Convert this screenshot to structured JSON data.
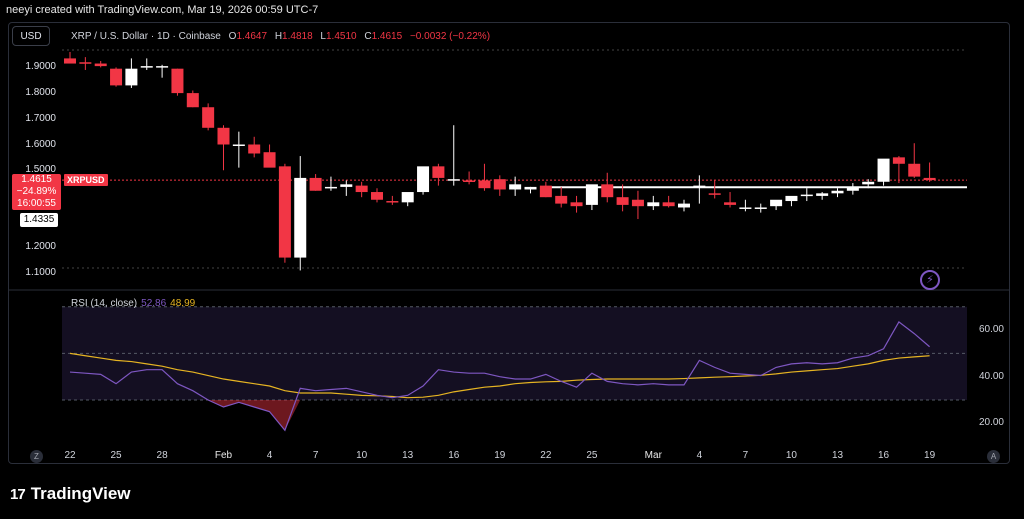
{
  "header": {
    "created_by": "neeyi created with TradingView.com, Mar 19, 2026 00:59 UTC-7",
    "currency_button": "USD"
  },
  "legend": {
    "title": "XRP / U.S. Dollar · 1D · Coinbase",
    "o_label": "O",
    "o_value": "1.4647",
    "h_label": "H",
    "h_value": "1.4818",
    "l_label": "L",
    "l_value": "1.4510",
    "c_label": "C",
    "c_value": "1.4615",
    "change": "−0.0032 (−0.22%)"
  },
  "price_tag": {
    "price": "1.4615",
    "change": "−24.89%",
    "countdown": "16:00:55",
    "symbol": "XRPUSD"
  },
  "hline_tag": "1.4335",
  "y_ticks": [
    "1.9000",
    "1.8000",
    "1.7000",
    "1.6000",
    "1.5000",
    "1.2000",
    "1.1000"
  ],
  "rsi": {
    "label": "RSI (14, close)",
    "value_rsi": "52.86",
    "value_ma": "48.99",
    "y_ticks": [
      "60.00",
      "40.00",
      "20.00"
    ]
  },
  "x_ticks": [
    "22",
    "25",
    "28",
    "Feb",
    "4",
    "7",
    "10",
    "13",
    "16",
    "19",
    "22",
    "25",
    "Mar",
    "4",
    "7",
    "10",
    "13",
    "16",
    "19"
  ],
  "corners": {
    "left": "Z",
    "right": "A"
  },
  "brand": {
    "name": "TradingView",
    "mark": "17"
  },
  "colors": {
    "up": "#ffffff",
    "down": "#f23645",
    "rsi": "#7e57c2",
    "rsi_ma": "#e6b422",
    "background": "#000000"
  },
  "chart_data": [
    {
      "type": "candlestick",
      "title": "XRP / U.S. Dollar · 1D · Coinbase",
      "x": [
        "Jan 22",
        "Jan 23",
        "Jan 24",
        "Jan 25",
        "Jan 26",
        "Jan 27",
        "Jan 28",
        "Jan 29",
        "Jan 30",
        "Jan 31",
        "Feb 1",
        "Feb 2",
        "Feb 3",
        "Feb 4",
        "Feb 5",
        "Feb 6",
        "Feb 7",
        "Feb 8",
        "Feb 9",
        "Feb 10",
        "Feb 11",
        "Feb 12",
        "Feb 13",
        "Feb 14",
        "Feb 15",
        "Feb 16",
        "Feb 17",
        "Feb 18",
        "Feb 19",
        "Feb 20",
        "Feb 21",
        "Feb 22",
        "Feb 23",
        "Feb 24",
        "Feb 25",
        "Feb 26",
        "Feb 27",
        "Feb 28",
        "Mar 1",
        "Mar 2",
        "Mar 3",
        "Mar 4",
        "Mar 5",
        "Mar 6",
        "Mar 7",
        "Mar 8",
        "Mar 9",
        "Mar 10",
        "Mar 11",
        "Mar 12",
        "Mar 13",
        "Mar 14",
        "Mar 15",
        "Mar 16",
        "Mar 17",
        "Mar 18",
        "Mar 19"
      ],
      "open": [
        1.935,
        1.92,
        1.915,
        1.895,
        1.83,
        1.905,
        1.905,
        1.895,
        1.8,
        1.745,
        1.665,
        1.6,
        1.6,
        1.57,
        1.515,
        1.16,
        1.47,
        1.435,
        1.435,
        1.44,
        1.415,
        1.38,
        1.375,
        1.415,
        1.515,
        1.465,
        1.46,
        1.46,
        1.465,
        1.425,
        1.425,
        1.44,
        1.4,
        1.375,
        1.365,
        1.445,
        1.395,
        1.385,
        1.36,
        1.375,
        1.355,
        1.44,
        1.41,
        1.375,
        1.355,
        1.35,
        1.36,
        1.38,
        1.4,
        1.4,
        1.41,
        1.42,
        1.445,
        1.455,
        1.55,
        1.525,
        1.47
      ],
      "high": [
        1.96,
        1.94,
        1.925,
        1.9,
        1.935,
        1.935,
        1.91,
        1.895,
        1.81,
        1.76,
        1.675,
        1.65,
        1.63,
        1.6,
        1.525,
        1.555,
        1.485,
        1.475,
        1.46,
        1.455,
        1.43,
        1.4,
        1.4,
        1.445,
        1.525,
        1.675,
        1.495,
        1.525,
        1.48,
        1.475,
        1.435,
        1.455,
        1.435,
        1.4,
        1.395,
        1.49,
        1.445,
        1.42,
        1.4,
        1.4,
        1.385,
        1.48,
        1.46,
        1.415,
        1.385,
        1.37,
        1.38,
        1.395,
        1.43,
        1.415,
        1.43,
        1.45,
        1.465,
        1.48,
        1.555,
        1.605,
        1.53
      ],
      "low": [
        1.92,
        1.89,
        1.9,
        1.825,
        1.82,
        1.89,
        1.86,
        1.79,
        1.745,
        1.655,
        1.5,
        1.51,
        1.55,
        1.54,
        1.14,
        1.11,
        1.42,
        1.42,
        1.4,
        1.395,
        1.375,
        1.365,
        1.36,
        1.405,
        1.44,
        1.44,
        1.445,
        1.42,
        1.4,
        1.4,
        1.41,
        1.395,
        1.355,
        1.335,
        1.345,
        1.375,
        1.34,
        1.31,
        1.345,
        1.355,
        1.34,
        1.37,
        1.39,
        1.355,
        1.34,
        1.335,
        1.345,
        1.36,
        1.38,
        1.385,
        1.395,
        1.405,
        1.43,
        1.44,
        1.45,
        1.47,
        1.455
      ],
      "close": [
        1.915,
        1.915,
        1.905,
        1.83,
        1.895,
        1.905,
        1.905,
        1.8,
        1.745,
        1.665,
        1.6,
        1.6,
        1.565,
        1.51,
        1.16,
        1.47,
        1.42,
        1.435,
        1.445,
        1.415,
        1.385,
        1.375,
        1.415,
        1.515,
        1.47,
        1.465,
        1.455,
        1.43,
        1.425,
        1.445,
        1.435,
        1.395,
        1.37,
        1.36,
        1.445,
        1.395,
        1.365,
        1.36,
        1.375,
        1.36,
        1.37,
        1.44,
        1.405,
        1.365,
        1.355,
        1.355,
        1.385,
        1.4,
        1.405,
        1.41,
        1.42,
        1.435,
        1.455,
        1.545,
        1.525,
        1.475,
        1.4615
      ],
      "ylim": [
        1.08,
        1.97
      ],
      "horizontal_line": 1.4335
    },
    {
      "type": "line",
      "title": "RSI (14, close)",
      "x": [
        "Jan 22",
        "Jan 23",
        "Jan 24",
        "Jan 25",
        "Jan 26",
        "Jan 27",
        "Jan 28",
        "Jan 29",
        "Jan 30",
        "Jan 31",
        "Feb 1",
        "Feb 2",
        "Feb 3",
        "Feb 4",
        "Feb 5",
        "Feb 6",
        "Feb 7",
        "Feb 8",
        "Feb 9",
        "Feb 10",
        "Feb 11",
        "Feb 12",
        "Feb 13",
        "Feb 14",
        "Feb 15",
        "Feb 16",
        "Feb 17",
        "Feb 18",
        "Feb 19",
        "Feb 20",
        "Feb 21",
        "Feb 22",
        "Feb 23",
        "Feb 24",
        "Feb 25",
        "Feb 26",
        "Feb 27",
        "Feb 28",
        "Mar 1",
        "Mar 2",
        "Mar 3",
        "Mar 4",
        "Mar 5",
        "Mar 6",
        "Mar 7",
        "Mar 8",
        "Mar 9",
        "Mar 10",
        "Mar 11",
        "Mar 12",
        "Mar 13",
        "Mar 14",
        "Mar 15",
        "Mar 16",
        "Mar 17",
        "Mar 18",
        "Mar 19"
      ],
      "series": [
        {
          "name": "RSI",
          "values": [
            42,
            41.5,
            41,
            37,
            42,
            43,
            43,
            37,
            34,
            30,
            27,
            29,
            27,
            25,
            17,
            35,
            34,
            34.5,
            35,
            33.5,
            32,
            31,
            32,
            36,
            43,
            42,
            41.5,
            41.5,
            40,
            39,
            39,
            41,
            38,
            35.5,
            41.5,
            38,
            37,
            36.5,
            37,
            36.5,
            36.5,
            47,
            44,
            41.5,
            41,
            40.5,
            44,
            45.5,
            46,
            45.5,
            46,
            48,
            49,
            52,
            63.5,
            58.5,
            52.86
          ]
        },
        {
          "name": "MA",
          "values": [
            50,
            49,
            48,
            47,
            46.5,
            45.5,
            44.5,
            43,
            42,
            40.5,
            39,
            38,
            37,
            36,
            34,
            33,
            33,
            33,
            32.5,
            32,
            31.8,
            31.5,
            31,
            31.2,
            32,
            33.5,
            34.5,
            35.5,
            36,
            37,
            37.5,
            37.8,
            38,
            38.5,
            38.8,
            39,
            39,
            39,
            39,
            39,
            39.2,
            39.5,
            39.8,
            40,
            40.3,
            40.6,
            41.2,
            42,
            42.5,
            43,
            43.5,
            44.5,
            45.5,
            47,
            48,
            48.5,
            48.99
          ]
        }
      ],
      "ylim": [
        14,
        70
      ],
      "bands": [
        30,
        50,
        70
      ]
    }
  ]
}
